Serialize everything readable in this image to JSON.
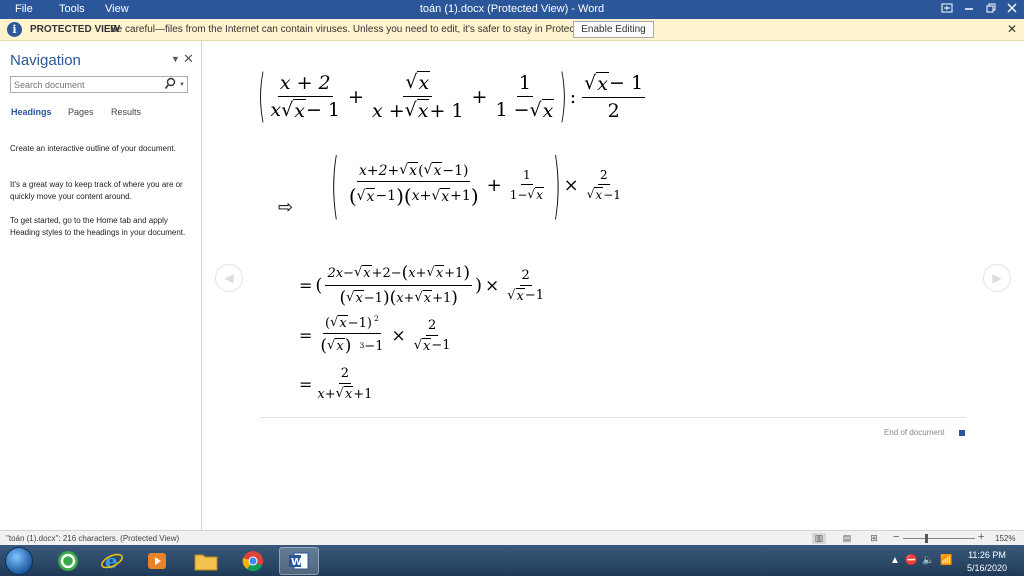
{
  "titlebar": {
    "menu": [
      "File",
      "Tools",
      "View"
    ],
    "title": "toán (1).docx (Protected View) - Word",
    "controls": [
      "restore-ribbon-icon",
      "minimize-icon",
      "maximize-icon",
      "close-icon"
    ]
  },
  "protected_bar": {
    "label": "PROTECTED VIEW",
    "message": "Be careful—files from the Internet can contain viruses. Unless you need to edit, it's safer to stay in Protected View.",
    "button": "Enable Editing",
    "icon": "info-icon"
  },
  "navigation": {
    "title": "Navigation",
    "search_placeholder": "Search document",
    "tabs": [
      "Headings",
      "Pages",
      "Results"
    ],
    "active_tab": "Headings",
    "paragraphs": [
      "Create an interactive outline of your document.",
      "It's a great way to keep track of where you are or quickly move your content around.",
      "To get started, go to the Home tab and apply Heading styles to the headings in your document."
    ]
  },
  "document": {
    "math": {
      "eq1": {
        "t1_num": "x + 2",
        "t1_den_x": "x",
        "t1_den_rad": "x",
        "t1_den_rest": " − 1",
        "plus": "+",
        "t2_num_rad": "x",
        "t2_den_a": "x + ",
        "t2_den_rad": "x",
        "t2_den_b": " + 1",
        "t3_num": "1",
        "t3_den_a": "1 − ",
        "t3_den_rad": "x",
        "colon": ":",
        "t4_num_rad": "x",
        "t4_num_rest": " − 1",
        "t4_den": "2"
      },
      "arrow": "⇨",
      "eq2": {
        "num_a": "x+2+",
        "num_rad1": "x",
        "num_rad2": "x",
        "num_b": "−1",
        "den_rad1": "x",
        "den_a": "−1",
        "den_b": "x+",
        "den_rad2": "x",
        "den_c": "+1",
        "plus": "+",
        "f2_num": "1",
        "f2_den_a": "1−",
        "f2_den_rad": "x",
        "times": "×",
        "f3_num": "2",
        "f3_den_rad": "x",
        "f3_den_rest": "−1"
      },
      "eq3": {
        "eq": "=",
        "open": "(",
        "num_a": "2x−",
        "num_rad1": "x",
        "num_b": "+2−",
        "num_c": "x+",
        "num_rad2": "x",
        "num_d": "+1",
        "den_rad1": "x",
        "den_a": "−1",
        "den_b": "x+",
        "den_rad2": "x",
        "den_c": "+1",
        "close": ")",
        "times": "×",
        "f2_num": "2",
        "f2_den_rad": "x",
        "f2_den_rest": "−1"
      },
      "eq4": {
        "eq": "=",
        "num_rad": "x",
        "num_rest": "−1)",
        "num_open": "(",
        "num_exp": "2",
        "den_rad": "x",
        "den_exp": "3",
        "den_rest": "−1",
        "times": "×",
        "f2_num": "2",
        "f2_den_rad": "x",
        "f2_den_rest": "−1"
      },
      "eq5": {
        "eq": "=",
        "num": "2",
        "den_a": "x+",
        "den_rad": "x",
        "den_b": "+1"
      }
    },
    "end_of_document": "End of document"
  },
  "statusbar": {
    "text": "\"toán (1).docx\": 216 characters.  (Protected View)",
    "zoom": "152%",
    "zoom_fraction": 0.32
  },
  "taskbar": {
    "apps": [
      "start-orb",
      "cleaner-icon",
      "internet-explorer-icon",
      "media-player-icon",
      "file-explorer-icon",
      "chrome-icon",
      "word-icon"
    ],
    "active_app": "word-icon",
    "time": "11:26 PM",
    "date": "5/16/2020"
  },
  "colors": {
    "word_blue": "#2b579a",
    "protected_bar": "#fff4ce",
    "taskbar": "#2a4a6b"
  }
}
